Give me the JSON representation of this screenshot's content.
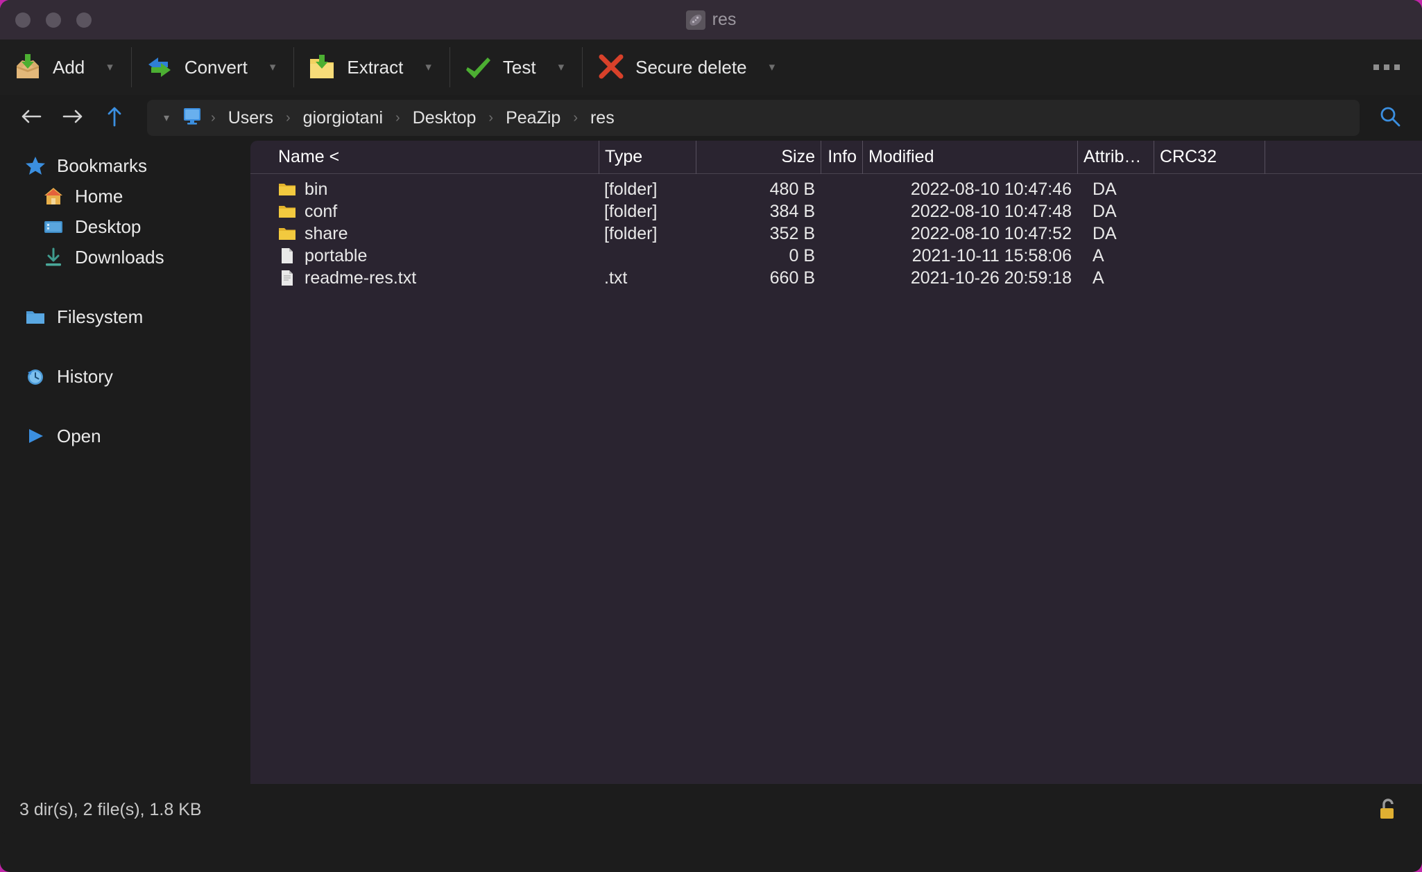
{
  "window": {
    "title": "res",
    "app_icon": "peazip-icon",
    "controls": [
      "close-button",
      "minimize-button",
      "maximize-button"
    ]
  },
  "toolbar": {
    "overflow_label": "more-options",
    "buttons": [
      {
        "label": "Add",
        "icon": "add-box-icon",
        "has_dropdown": true
      },
      {
        "label": "Convert",
        "icon": "convert-arrows-icon",
        "has_dropdown": true
      },
      {
        "label": "Extract",
        "icon": "extract-folder-icon",
        "has_dropdown": true
      },
      {
        "label": "Test",
        "icon": "check-mark-icon",
        "has_dropdown": true
      },
      {
        "label": "Secure delete",
        "icon": "red-x-icon",
        "has_dropdown": true
      }
    ]
  },
  "addressbar": {
    "back_icon": "arrow-left-icon",
    "forward_icon": "arrow-right-icon",
    "up_icon": "arrow-up-icon",
    "dropdown_icon": "chevron-down-icon",
    "root_icon": "computer-monitor-icon",
    "search_icon": "search-icon",
    "separator": "›",
    "crumbs": [
      "Users",
      "giorgiotani",
      "Desktop",
      "PeaZip",
      "res"
    ]
  },
  "sidebar": {
    "items": [
      {
        "label": "Bookmarks",
        "icon": "star-icon",
        "indent": false
      },
      {
        "label": "Home",
        "icon": "house-icon",
        "indent": true
      },
      {
        "label": "Desktop",
        "icon": "monitor-icon",
        "indent": true
      },
      {
        "label": "Downloads",
        "icon": "download-icon",
        "indent": true
      },
      {
        "label": "Filesystem",
        "icon": "folder-icon",
        "indent": false
      },
      {
        "label": "History",
        "icon": "clock-icon",
        "indent": false
      },
      {
        "label": "Open",
        "icon": "play-icon",
        "indent": false
      }
    ]
  },
  "filelist": {
    "columns": [
      {
        "key": "name",
        "label": "Name <"
      },
      {
        "key": "type",
        "label": "Type"
      },
      {
        "key": "size",
        "label": "Size"
      },
      {
        "key": "info",
        "label": "Info"
      },
      {
        "key": "modified",
        "label": "Modified"
      },
      {
        "key": "attrib",
        "label": "Attrib…"
      },
      {
        "key": "crc32",
        "label": "CRC32"
      }
    ],
    "sort_column": "Name",
    "sort_indicator": "<",
    "rows": [
      {
        "icon": "folder-icon",
        "name": "bin",
        "type": "[folder]",
        "size": "480 B",
        "info": "",
        "modified": "2022-08-10 10:47:46",
        "attrib": "DA",
        "crc32": ""
      },
      {
        "icon": "folder-icon",
        "name": "conf",
        "type": "[folder]",
        "size": "384 B",
        "info": "",
        "modified": "2022-08-10 10:47:48",
        "attrib": "DA",
        "crc32": ""
      },
      {
        "icon": "folder-icon",
        "name": "share",
        "type": "[folder]",
        "size": "352 B",
        "info": "",
        "modified": "2022-08-10 10:47:52",
        "attrib": "DA",
        "crc32": ""
      },
      {
        "icon": "file-icon",
        "name": "portable",
        "type": "",
        "size": "0 B",
        "info": "",
        "modified": "2021-10-11 15:58:06",
        "attrib": "A",
        "crc32": ""
      },
      {
        "icon": "file-icon",
        "name": "readme-res.txt",
        "type": ".txt",
        "size": "660 B",
        "info": "",
        "modified": "2021-10-26 20:59:18",
        "attrib": "A",
        "crc32": ""
      }
    ]
  },
  "statusbar": {
    "summary": "3 dir(s), 2 file(s), 1.8 KB",
    "lock_icon": "unlocked-padlock-icon"
  },
  "colors": {
    "window_bg": "#1c1c1c",
    "titlebar_bg": "#332b36",
    "list_bg": "#2a2430",
    "accent_blue": "#3b8fe0",
    "folder_yellow": "#f0c23c",
    "green": "#4caf32",
    "red": "#d8412a"
  }
}
